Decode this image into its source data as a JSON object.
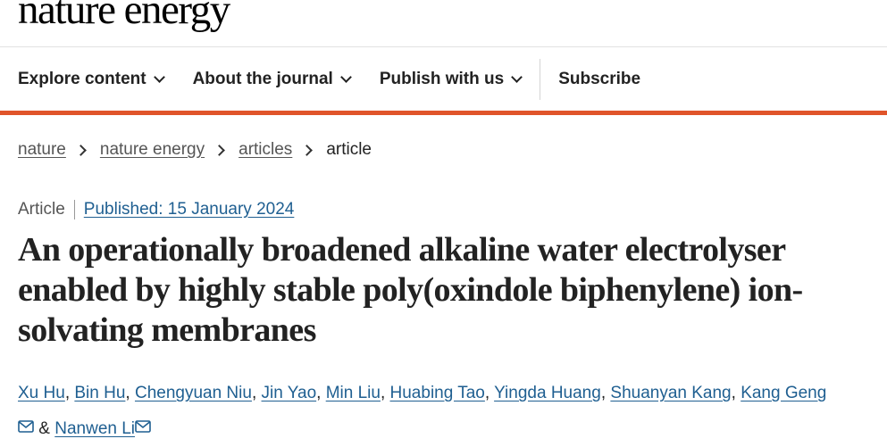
{
  "header": {
    "logo_text": "nature energy"
  },
  "nav": {
    "items": [
      {
        "label": "Explore content",
        "icon": "chevron-down-icon"
      },
      {
        "label": "About the journal",
        "icon": "chevron-down-icon"
      },
      {
        "label": "Publish with us",
        "icon": "chevron-down-icon"
      }
    ],
    "subscribe_label": "Subscribe"
  },
  "accent_color": "#e0542a",
  "link_color": "#1f5f91",
  "breadcrumb": {
    "items": [
      "nature",
      "nature energy",
      "articles"
    ],
    "current": "article",
    "separator_icon": "chevron-right-icon"
  },
  "article": {
    "type": "Article",
    "published": "Published: 15 January 2024",
    "title": "An operationally broadened alkaline water electrolyser enabled by highly stable poly(oxindole biphenylene) ion-solvating membranes",
    "authors": [
      "Xu Hu",
      "Bin Hu",
      "Chengyuan Niu",
      "Jin Yao",
      "Min Liu",
      "Huabing Tao",
      "Yingda Huang",
      "Shuanyan Kang",
      "Kang Geng",
      "Nanwen Li"
    ],
    "author_separator": ",",
    "author_conjunction": "&",
    "mail_icon": "envelope-icon"
  }
}
